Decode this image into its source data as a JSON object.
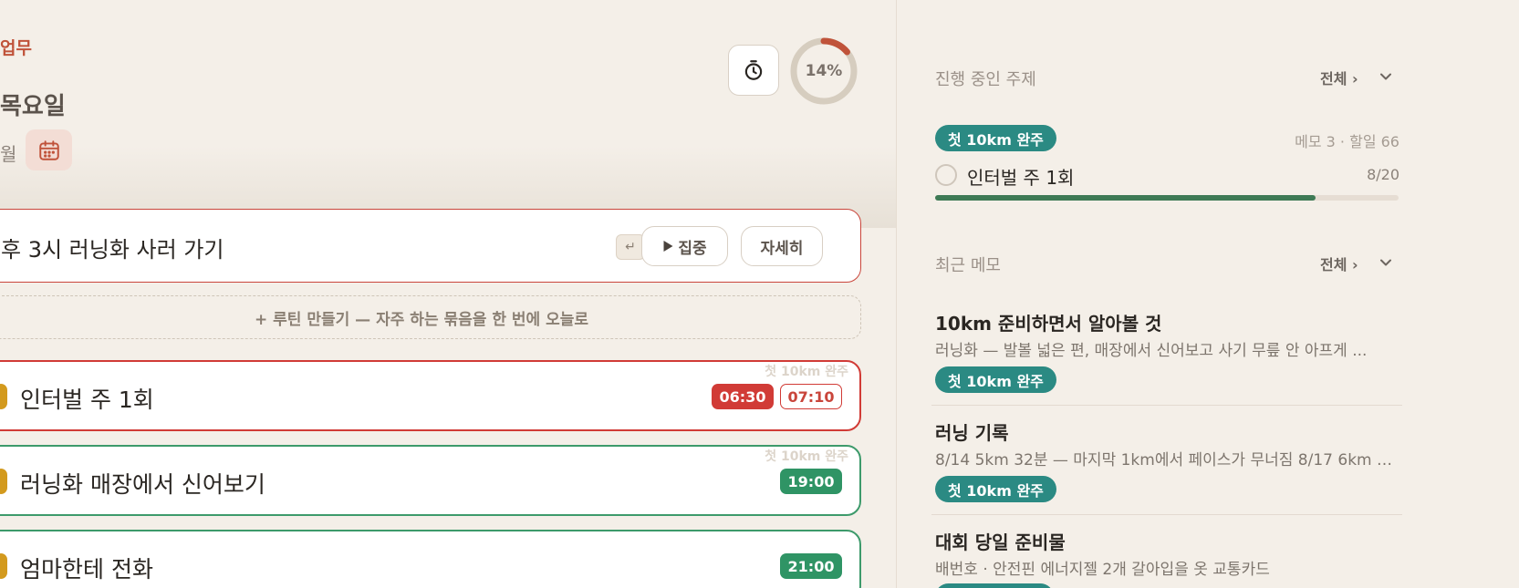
{
  "header": {
    "category": "업무",
    "weekday": "목요일",
    "month": "월",
    "progress_percent": 14,
    "progress_label": "14%"
  },
  "focus_task": {
    "title": "후 3시 러닝화 사러 가기",
    "enter_hint": "↵",
    "focus_label": "집중",
    "detail_label": "자세히"
  },
  "routine": {
    "label": "+ 루틴 만들기 — 자주 하는 묶음을 한 번에 오늘로"
  },
  "tasks": [
    {
      "title": "인터벌 주 1회",
      "goal": "첫 10km 완주",
      "start": "06:30",
      "end": "07:10"
    },
    {
      "title": "러닝화 매장에서 신어보기",
      "goal": "첫 10km 완주",
      "time": "19:00"
    },
    {
      "title": "엄마한테 전화",
      "time": "21:00"
    }
  ],
  "sidebar": {
    "topics": {
      "heading": "진행 중인 주제",
      "see_all": "전체 ›",
      "topic_tag": "첫 10km 완주",
      "topic_meta": "메모 3 · 할일 66",
      "subtask_title": "인터벌 주 1회",
      "subtask_count": "8/20",
      "subtask_progress": 0.82
    },
    "memos": {
      "heading": "최근 메모",
      "see_all": "전체 ›",
      "items": [
        {
          "title": "10km 준비하면서 알아볼 것",
          "preview": "러닝화 — 발볼 넓은 편, 매장에서 신어보고 사기 무릎 안 아프게 ...",
          "tag": "첫 10km 완주"
        },
        {
          "title": "러닝 기록",
          "preview": "8/14 5km 32분 — 마지막 1km에서 페이스가 무너짐 8/17 6km 3...",
          "tag": "첫 10km 완주"
        },
        {
          "title": "대회 당일 준비물",
          "preview": "배번호 · 안전핀 에너지젤 2개 갈아입을 옷 교통카드"
        }
      ]
    }
  },
  "colors": {
    "accent_red": "#c9453b",
    "accent_green": "#2f9465",
    "teal_tag": "#2b8a83",
    "progress_fill": "#3e7a55",
    "background": "#f4efe8"
  },
  "icons": {
    "calendar": "calendar-icon",
    "timer": "stopwatch-icon",
    "play": "play-icon",
    "chevron": "chevron-down-icon"
  }
}
